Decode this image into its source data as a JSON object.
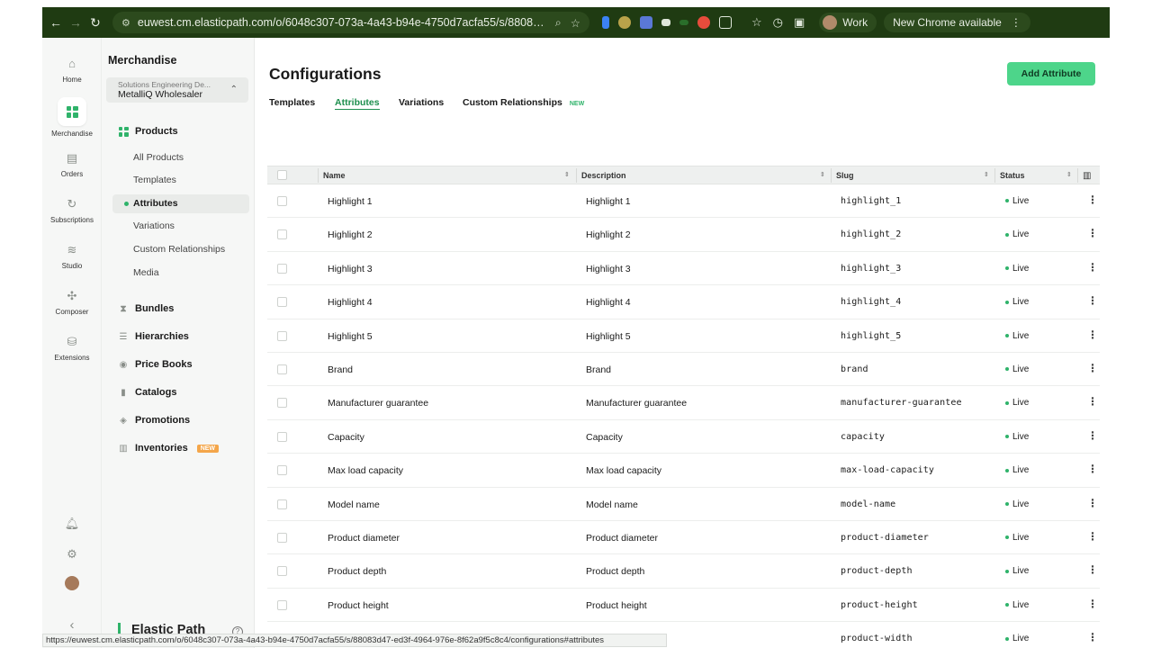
{
  "browser": {
    "url": "euwest.cm.elasticpath.com/o/6048c307-073a-4a43-b94e-4750d7acfa55/s/88083d47-...",
    "profile_label": "Work",
    "update_label": "New Chrome available",
    "status_url": "https://euwest.cm.elasticpath.com/o/6048c307-073a-4a43-b94e-4750d7acfa55/s/88083d47-ed3f-4964-976e-8f62a9f5c8c4/configurations#attributes"
  },
  "rail": {
    "items": [
      {
        "label": "Home",
        "icon": "home-icon"
      },
      {
        "label": "Merchandise",
        "icon": "merchandise-icon"
      },
      {
        "label": "Orders",
        "icon": "orders-icon"
      },
      {
        "label": "Subscriptions",
        "icon": "subscriptions-icon"
      },
      {
        "label": "Studio",
        "icon": "studio-icon"
      },
      {
        "label": "Composer",
        "icon": "composer-icon"
      },
      {
        "label": "Extensions",
        "icon": "extensions-icon"
      }
    ]
  },
  "sidebar": {
    "title": "Merchandise",
    "org_line1": "Solutions Engineering De...",
    "org_line2": "MetalliQ Wholesaler",
    "products_label": "Products",
    "sub_items": [
      "All Products",
      "Templates",
      "Attributes",
      "Variations",
      "Custom Relationships",
      "Media"
    ],
    "active_sub": "Attributes",
    "groups": [
      "Bundles",
      "Hierarchies",
      "Price Books",
      "Catalogs",
      "Promotions",
      "Inventories"
    ],
    "inventories_badge": "NEW",
    "brand": "Elastic Path",
    "help": "?"
  },
  "main": {
    "title": "Configurations",
    "add_button": "Add Attribute",
    "tabs": [
      "Templates",
      "Attributes",
      "Variations",
      "Custom Relationships"
    ],
    "active_tab": "Attributes",
    "tab_badge": "NEW",
    "columns": {
      "name": "Name",
      "description": "Description",
      "slug": "Slug",
      "status": "Status"
    },
    "rows": [
      {
        "name": "Highlight 1",
        "description": "Highlight 1",
        "slug": "highlight_1",
        "status": "Live"
      },
      {
        "name": "Highlight 2",
        "description": "Highlight 2",
        "slug": "highlight_2",
        "status": "Live"
      },
      {
        "name": "Highlight 3",
        "description": "Highlight 3",
        "slug": "highlight_3",
        "status": "Live"
      },
      {
        "name": "Highlight 4",
        "description": "Highlight 4",
        "slug": "highlight_4",
        "status": "Live"
      },
      {
        "name": "Highlight 5",
        "description": "Highlight 5",
        "slug": "highlight_5",
        "status": "Live"
      },
      {
        "name": "Brand",
        "description": "Brand",
        "slug": "brand",
        "status": "Live"
      },
      {
        "name": "Manufacturer guarantee",
        "description": "Manufacturer guarantee",
        "slug": "manufacturer-guarantee",
        "status": "Live"
      },
      {
        "name": "Capacity",
        "description": "Capacity",
        "slug": "capacity",
        "status": "Live"
      },
      {
        "name": "Max load capacity",
        "description": "Max load capacity",
        "slug": "max-load-capacity",
        "status": "Live"
      },
      {
        "name": "Model name",
        "description": "Model name",
        "slug": "model-name",
        "status": "Live"
      },
      {
        "name": "Product diameter",
        "description": "Product diameter",
        "slug": "product-diameter",
        "status": "Live"
      },
      {
        "name": "Product depth",
        "description": "Product depth",
        "slug": "product-depth",
        "status": "Live"
      },
      {
        "name": "Product height",
        "description": "Product height",
        "slug": "product-height",
        "status": "Live"
      },
      {
        "name": "",
        "description": "",
        "slug": "product-width",
        "status": "Live"
      }
    ]
  },
  "colors": {
    "accent": "#2fb36a",
    "button": "#4dd58a",
    "browser_bar": "#1f3b12"
  }
}
